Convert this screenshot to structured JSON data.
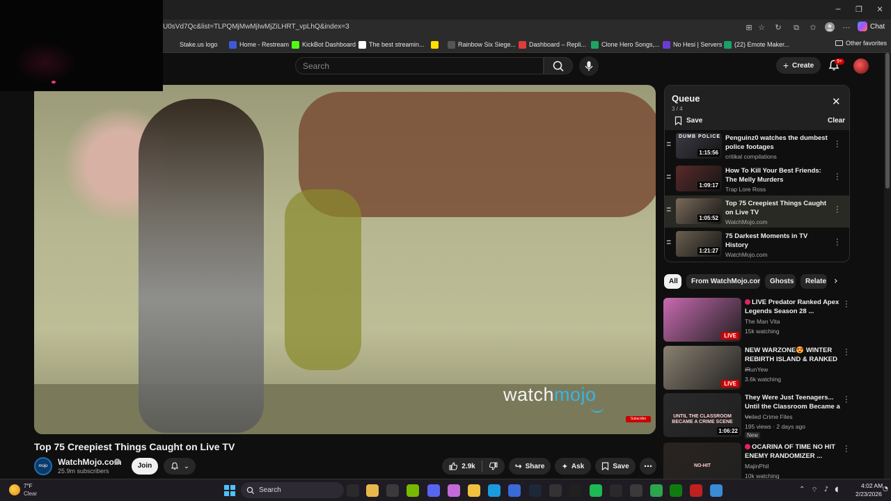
{
  "browser": {
    "url": "U0sVd7Qc&list=TLPQMjMwMjIwMjZiLHRT_vpLhQ&index=3",
    "copilot_label": "Chat",
    "bookmarks": [
      {
        "label": "Stake.us logo",
        "color": "#2b2b2b",
        "icon": "s-icon"
      },
      {
        "label": "Home - Restream",
        "color": "#3b5bd6",
        "icon": "r-icon"
      },
      {
        "label": "KickBot Dashboard",
        "color": "#53fc18",
        "icon": "kick-icon"
      },
      {
        "label": "The best streamin...",
        "color": "#ffffff",
        "icon": "diamond-icon"
      },
      {
        "label": "",
        "color": "#ffde00",
        "icon": "snapchat-icon"
      },
      {
        "label": "Rainbow Six Siege...",
        "color": "#555555",
        "icon": "r6-icon"
      },
      {
        "label": "Dashboard – Repli...",
        "color": "#e23b3b",
        "icon": "replit-icon"
      },
      {
        "label": "Clone Hero Songs,...",
        "color": "#1da462",
        "icon": "sheets-icon"
      },
      {
        "label": "No Hesi | Servers",
        "color": "#6c3bd6",
        "icon": "n-icon"
      },
      {
        "label": "(22) Emote Maker...",
        "color": "#1aa06a",
        "icon": "emote-icon"
      }
    ],
    "other_favorites": "Other favorites"
  },
  "youtube": {
    "search_placeholder": "Search",
    "create_label": "Create",
    "notification_count": "9+",
    "player": {
      "watermark_left": "watch",
      "watermark_right": "mojo",
      "subscribe_badge": "Subscribe"
    },
    "video": {
      "title": "Top 75 Creepiest Things Caught on Live TV",
      "channel": "WatchMojo.com",
      "channel_avatar_text": "mojo",
      "subscribers": "25.9m subscribers",
      "join_label": "Join",
      "likes": "2.9k",
      "share_label": "Share",
      "ask_label": "Ask",
      "save_label": "Save"
    },
    "queue": {
      "title": "Queue",
      "position": "3 / 4",
      "save_label": "Save",
      "clear_label": "Clear",
      "items": [
        {
          "title": "Penguinz0 watches the dumbest police footages",
          "channel": "critikal compilations",
          "duration": "1:15:56",
          "thumb_text": "DUMB POLICE",
          "thumb_color": "#3a3a44"
        },
        {
          "title": "How To Kill Your Best Friends: The Melly Murders",
          "channel": "Trap Lore Ross",
          "duration": "1:09:17",
          "thumb_text": "",
          "thumb_color": "#5a2a2a"
        },
        {
          "title": "Top 75 Creepiest Things Caught on Live TV",
          "channel": "WatchMojo.com",
          "duration": "1:05:52",
          "thumb_text": "",
          "thumb_color": "#7a6a5a"
        },
        {
          "title": "75 Darkest Moments in TV History",
          "channel": "WatchMojo.com",
          "duration": "1:21:27",
          "thumb_text": "",
          "thumb_color": "#6a6050"
        }
      ]
    },
    "chips": [
      "All",
      "From WatchMojo.com",
      "Ghosts",
      "Relate"
    ],
    "recommendations": [
      {
        "title": "LIVE Predator Ranked Apex Legends Season 28 ...",
        "channel": "The Man Vita",
        "meta": "15k watching",
        "live": true,
        "badge": "LIVE",
        "thumb_color": "#c86ab0",
        "dots": true
      },
      {
        "title": "NEW WARZONE😍 WINTER REBIRTH ISLAND & RANKED ...",
        "channel": "iRunYew",
        "meta": "3.6k watching",
        "live": true,
        "badge": "LIVE",
        "thumb_color": "#8a8070",
        "dots": false
      },
      {
        "title": "They Were Just Teenagers... Until the Classroom Became a ...",
        "channel": "Veiled Crime Files",
        "meta": "195 views · 2 days ago",
        "live": false,
        "badge": "1:06:22",
        "new": "New",
        "thumb_text": "UNTIL THE CLASSROOM BECAME A CRIME SCENE",
        "thumb_color": "#2a2a2a",
        "dots": false
      },
      {
        "title": "OCARINA OF TIME NO HIT ENEMY RANDOMIZER ...",
        "channel": "MajinPhil",
        "meta": "10k watching",
        "live": true,
        "badge": "",
        "thumb_text": "NO-HIT",
        "thumb_color": "#2a2420",
        "dots": true
      }
    ]
  },
  "taskbar": {
    "temperature": "7°F",
    "condition": "Clear",
    "search_label": "Search",
    "time": "4:02 AM",
    "date": "2/23/2026",
    "apps": [
      {
        "name": "explorer-app-icon",
        "color": "#2a2a2a"
      },
      {
        "name": "file-manager-icon",
        "color": "#e8b84a"
      },
      {
        "name": "terminal-icon",
        "color": "#3a3a3a"
      },
      {
        "name": "nvidia-icon",
        "color": "#76b900"
      },
      {
        "name": "discord-icon",
        "color": "#5865f2"
      },
      {
        "name": "copilot-icon",
        "color": "#c06bd8"
      },
      {
        "name": "folder-icon",
        "color": "#f0c040"
      },
      {
        "name": "edge-icon",
        "color": "#1a9be0"
      },
      {
        "name": "store-icon",
        "color": "#3a6ad6"
      },
      {
        "name": "steam-icon",
        "color": "#1b2838"
      },
      {
        "name": "github-icon",
        "color": "#333333"
      },
      {
        "name": "obs-icon",
        "color": "#202020"
      },
      {
        "name": "spotify-icon",
        "color": "#1db954"
      },
      {
        "name": "4k-icon",
        "color": "#2a2a2a"
      },
      {
        "name": "twitch-icon",
        "color": "#3a3a3a"
      },
      {
        "name": "b-app-icon",
        "color": "#2da44e"
      },
      {
        "name": "xbox-icon",
        "color": "#107c10"
      },
      {
        "name": "streamer-icon",
        "color": "#c02020"
      },
      {
        "name": "window-app-icon",
        "color": "#3a8ad6"
      }
    ]
  }
}
